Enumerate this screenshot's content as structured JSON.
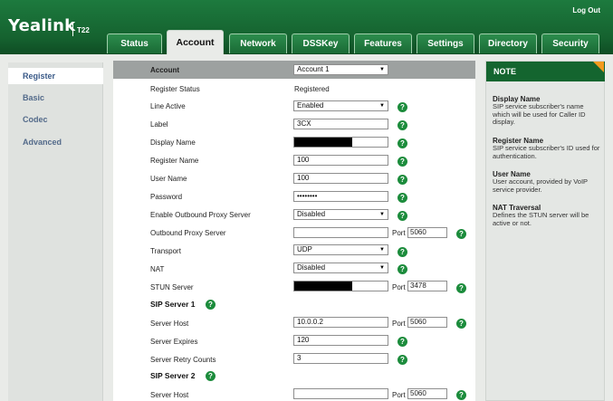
{
  "header": {
    "brand": "Yealink",
    "model": "T22",
    "logout": "Log Out",
    "tabs": [
      "Status",
      "Account",
      "Network",
      "DSSKey",
      "Features",
      "Settings",
      "Directory",
      "Security"
    ],
    "active_tab": "Account"
  },
  "sidebar": {
    "items": [
      "Register",
      "Basic",
      "Codec",
      "Advanced"
    ],
    "active": "Register"
  },
  "form": {
    "account_label": "Account",
    "account_value": "Account 1",
    "register_status_label": "Register Status",
    "register_status_value": "Registered",
    "line_active_label": "Line Active",
    "line_active_value": "Enabled",
    "label_label": "Label",
    "label_value": "3CX",
    "display_name_label": "Display Name",
    "register_name_label": "Register Name",
    "register_name_value": "100",
    "user_name_label": "User Name",
    "user_name_value": "100",
    "password_label": "Password",
    "password_value": "••••••••",
    "outbound_proxy_enable_label": "Enable Outbound Proxy Server",
    "outbound_proxy_enable_value": "Disabled",
    "outbound_proxy_label": "Outbound Proxy Server",
    "outbound_proxy_value": "",
    "outbound_proxy_port": "5060",
    "transport_label": "Transport",
    "transport_value": "UDP",
    "nat_label": "NAT",
    "nat_value": "Disabled",
    "stun_label": "STUN Server",
    "stun_port": "3478",
    "port_label": "Port",
    "sip1_label": "SIP Server 1",
    "sip1_host_label": "Server Host",
    "sip1_host_value": "10.0.0.2",
    "sip1_port": "5060",
    "sip1_expires_label": "Server Expires",
    "sip1_expires_value": "120",
    "sip1_retry_label": "Server Retry Counts",
    "sip1_retry_value": "3",
    "sip2_label": "SIP Server 2",
    "sip2_host_label": "Server Host",
    "sip2_host_value": "",
    "sip2_port": "5060",
    "help_glyph": "?"
  },
  "note": {
    "title": "NOTE",
    "entries": [
      {
        "title": "Display Name",
        "text": "SIP service subscriber's name which will be used for Caller ID display."
      },
      {
        "title": "Register Name",
        "text": "SIP service subscriber's ID used for authentication."
      },
      {
        "title": "User Name",
        "text": "User account, provided by VoIP service provider."
      },
      {
        "title": "NAT Traversal",
        "text": "Defines the STUN server will be active or not."
      }
    ]
  },
  "colors": {
    "header_green": "#15622f",
    "help_green": "#1c8c3c",
    "note_corner": "#f39a1e"
  }
}
